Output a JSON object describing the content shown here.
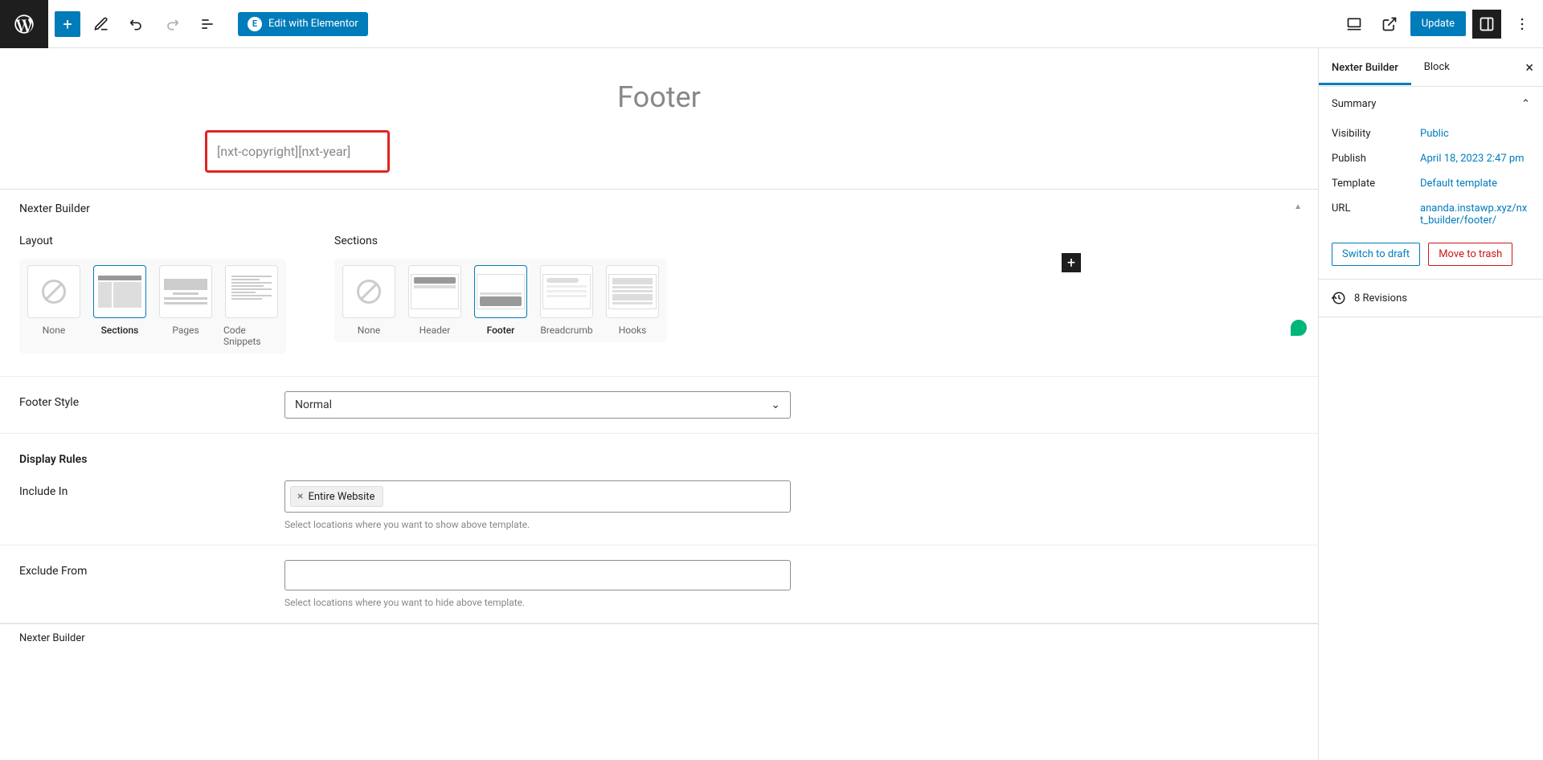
{
  "topbar": {
    "elementor_label": "Edit with Elementor",
    "update_label": "Update"
  },
  "canvas": {
    "title": "Footer",
    "shortcode": "[nxt-copyright][nxt-year]"
  },
  "meta": {
    "panel_title": "Nexter Builder",
    "layout_label": "Layout",
    "sections_label": "Sections",
    "layout_options": [
      "None",
      "Sections",
      "Pages",
      "Code Snippets"
    ],
    "section_options": [
      "None",
      "Header",
      "Footer",
      "Breadcrumb",
      "Hooks"
    ],
    "footer_style_label": "Footer Style",
    "footer_style_value": "Normal",
    "display_rules_label": "Display Rules",
    "include_label": "Include In",
    "include_chip": "Entire Website",
    "include_help": "Select locations where you want to show above template.",
    "exclude_label": "Exclude From",
    "exclude_help": "Select locations where you want to hide above template.",
    "bottom_crumb": "Nexter Builder"
  },
  "sidebar": {
    "tab1": "Nexter Builder",
    "tab2": "Block",
    "summary_label": "Summary",
    "visibility_key": "Visibility",
    "visibility_val": "Public",
    "publish_key": "Publish",
    "publish_val": "April 18, 2023 2:47 pm",
    "template_key": "Template",
    "template_val": "Default template",
    "url_key": "URL",
    "url_val": "ananda.instawp.xyz/nxt_builder/footer/",
    "draft_label": "Switch to draft",
    "trash_label": "Move to trash",
    "revisions_label": "8 Revisions"
  }
}
